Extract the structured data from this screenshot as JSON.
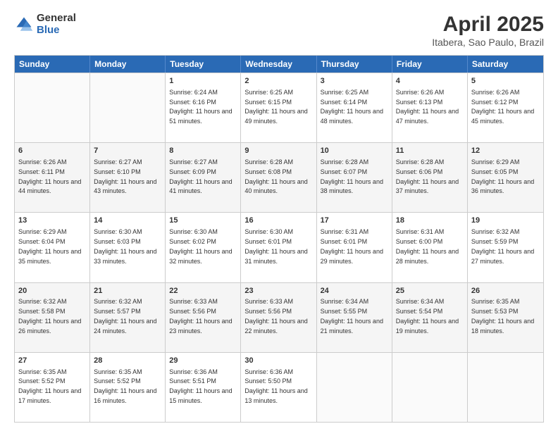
{
  "header": {
    "logo_general": "General",
    "logo_blue": "Blue",
    "title": "April 2025",
    "subtitle": "Itabera, Sao Paulo, Brazil"
  },
  "weekdays": [
    "Sunday",
    "Monday",
    "Tuesday",
    "Wednesday",
    "Thursday",
    "Friday",
    "Saturday"
  ],
  "rows": [
    [
      {
        "day": "",
        "sunrise": "",
        "sunset": "",
        "daylight": "",
        "empty": true
      },
      {
        "day": "",
        "sunrise": "",
        "sunset": "",
        "daylight": "",
        "empty": true
      },
      {
        "day": "1",
        "sunrise": "Sunrise: 6:24 AM",
        "sunset": "Sunset: 6:16 PM",
        "daylight": "Daylight: 11 hours and 51 minutes.",
        "empty": false
      },
      {
        "day": "2",
        "sunrise": "Sunrise: 6:25 AM",
        "sunset": "Sunset: 6:15 PM",
        "daylight": "Daylight: 11 hours and 49 minutes.",
        "empty": false
      },
      {
        "day": "3",
        "sunrise": "Sunrise: 6:25 AM",
        "sunset": "Sunset: 6:14 PM",
        "daylight": "Daylight: 11 hours and 48 minutes.",
        "empty": false
      },
      {
        "day": "4",
        "sunrise": "Sunrise: 6:26 AM",
        "sunset": "Sunset: 6:13 PM",
        "daylight": "Daylight: 11 hours and 47 minutes.",
        "empty": false
      },
      {
        "day": "5",
        "sunrise": "Sunrise: 6:26 AM",
        "sunset": "Sunset: 6:12 PM",
        "daylight": "Daylight: 11 hours and 45 minutes.",
        "empty": false
      }
    ],
    [
      {
        "day": "6",
        "sunrise": "Sunrise: 6:26 AM",
        "sunset": "Sunset: 6:11 PM",
        "daylight": "Daylight: 11 hours and 44 minutes.",
        "empty": false
      },
      {
        "day": "7",
        "sunrise": "Sunrise: 6:27 AM",
        "sunset": "Sunset: 6:10 PM",
        "daylight": "Daylight: 11 hours and 43 minutes.",
        "empty": false
      },
      {
        "day": "8",
        "sunrise": "Sunrise: 6:27 AM",
        "sunset": "Sunset: 6:09 PM",
        "daylight": "Daylight: 11 hours and 41 minutes.",
        "empty": false
      },
      {
        "day": "9",
        "sunrise": "Sunrise: 6:28 AM",
        "sunset": "Sunset: 6:08 PM",
        "daylight": "Daylight: 11 hours and 40 minutes.",
        "empty": false
      },
      {
        "day": "10",
        "sunrise": "Sunrise: 6:28 AM",
        "sunset": "Sunset: 6:07 PM",
        "daylight": "Daylight: 11 hours and 38 minutes.",
        "empty": false
      },
      {
        "day": "11",
        "sunrise": "Sunrise: 6:28 AM",
        "sunset": "Sunset: 6:06 PM",
        "daylight": "Daylight: 11 hours and 37 minutes.",
        "empty": false
      },
      {
        "day": "12",
        "sunrise": "Sunrise: 6:29 AM",
        "sunset": "Sunset: 6:05 PM",
        "daylight": "Daylight: 11 hours and 36 minutes.",
        "empty": false
      }
    ],
    [
      {
        "day": "13",
        "sunrise": "Sunrise: 6:29 AM",
        "sunset": "Sunset: 6:04 PM",
        "daylight": "Daylight: 11 hours and 35 minutes.",
        "empty": false
      },
      {
        "day": "14",
        "sunrise": "Sunrise: 6:30 AM",
        "sunset": "Sunset: 6:03 PM",
        "daylight": "Daylight: 11 hours and 33 minutes.",
        "empty": false
      },
      {
        "day": "15",
        "sunrise": "Sunrise: 6:30 AM",
        "sunset": "Sunset: 6:02 PM",
        "daylight": "Daylight: 11 hours and 32 minutes.",
        "empty": false
      },
      {
        "day": "16",
        "sunrise": "Sunrise: 6:30 AM",
        "sunset": "Sunset: 6:01 PM",
        "daylight": "Daylight: 11 hours and 31 minutes.",
        "empty": false
      },
      {
        "day": "17",
        "sunrise": "Sunrise: 6:31 AM",
        "sunset": "Sunset: 6:01 PM",
        "daylight": "Daylight: 11 hours and 29 minutes.",
        "empty": false
      },
      {
        "day": "18",
        "sunrise": "Sunrise: 6:31 AM",
        "sunset": "Sunset: 6:00 PM",
        "daylight": "Daylight: 11 hours and 28 minutes.",
        "empty": false
      },
      {
        "day": "19",
        "sunrise": "Sunrise: 6:32 AM",
        "sunset": "Sunset: 5:59 PM",
        "daylight": "Daylight: 11 hours and 27 minutes.",
        "empty": false
      }
    ],
    [
      {
        "day": "20",
        "sunrise": "Sunrise: 6:32 AM",
        "sunset": "Sunset: 5:58 PM",
        "daylight": "Daylight: 11 hours and 26 minutes.",
        "empty": false
      },
      {
        "day": "21",
        "sunrise": "Sunrise: 6:32 AM",
        "sunset": "Sunset: 5:57 PM",
        "daylight": "Daylight: 11 hours and 24 minutes.",
        "empty": false
      },
      {
        "day": "22",
        "sunrise": "Sunrise: 6:33 AM",
        "sunset": "Sunset: 5:56 PM",
        "daylight": "Daylight: 11 hours and 23 minutes.",
        "empty": false
      },
      {
        "day": "23",
        "sunrise": "Sunrise: 6:33 AM",
        "sunset": "Sunset: 5:56 PM",
        "daylight": "Daylight: 11 hours and 22 minutes.",
        "empty": false
      },
      {
        "day": "24",
        "sunrise": "Sunrise: 6:34 AM",
        "sunset": "Sunset: 5:55 PM",
        "daylight": "Daylight: 11 hours and 21 minutes.",
        "empty": false
      },
      {
        "day": "25",
        "sunrise": "Sunrise: 6:34 AM",
        "sunset": "Sunset: 5:54 PM",
        "daylight": "Daylight: 11 hours and 19 minutes.",
        "empty": false
      },
      {
        "day": "26",
        "sunrise": "Sunrise: 6:35 AM",
        "sunset": "Sunset: 5:53 PM",
        "daylight": "Daylight: 11 hours and 18 minutes.",
        "empty": false
      }
    ],
    [
      {
        "day": "27",
        "sunrise": "Sunrise: 6:35 AM",
        "sunset": "Sunset: 5:52 PM",
        "daylight": "Daylight: 11 hours and 17 minutes.",
        "empty": false
      },
      {
        "day": "28",
        "sunrise": "Sunrise: 6:35 AM",
        "sunset": "Sunset: 5:52 PM",
        "daylight": "Daylight: 11 hours and 16 minutes.",
        "empty": false
      },
      {
        "day": "29",
        "sunrise": "Sunrise: 6:36 AM",
        "sunset": "Sunset: 5:51 PM",
        "daylight": "Daylight: 11 hours and 15 minutes.",
        "empty": false
      },
      {
        "day": "30",
        "sunrise": "Sunrise: 6:36 AM",
        "sunset": "Sunset: 5:50 PM",
        "daylight": "Daylight: 11 hours and 13 minutes.",
        "empty": false
      },
      {
        "day": "",
        "sunrise": "",
        "sunset": "",
        "daylight": "",
        "empty": true
      },
      {
        "day": "",
        "sunrise": "",
        "sunset": "",
        "daylight": "",
        "empty": true
      },
      {
        "day": "",
        "sunrise": "",
        "sunset": "",
        "daylight": "",
        "empty": true
      }
    ]
  ]
}
